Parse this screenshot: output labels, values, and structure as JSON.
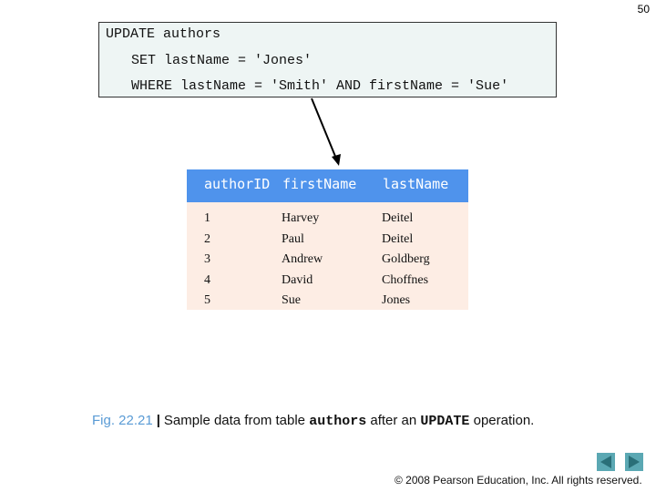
{
  "page_number": "50",
  "code": {
    "line1": "UPDATE authors",
    "line2": "SET lastName = 'Jones'",
    "line3": "WHERE lastName = 'Smith' AND firstName = 'Sue'"
  },
  "table": {
    "headers": [
      "authorID",
      "firstName",
      "lastName"
    ],
    "rows": [
      [
        "1",
        "Harvey",
        "Deitel"
      ],
      [
        "2",
        "Paul",
        "Deitel"
      ],
      [
        "3",
        "Andrew",
        "Goldberg"
      ],
      [
        "4",
        "David",
        "Choffnes"
      ],
      [
        "5",
        "Sue",
        "Jones"
      ]
    ]
  },
  "caption": {
    "fig_label": "Fig. 22.21",
    "separator": "|",
    "text1": "Sample data from table",
    "code1": "authors",
    "text2": "after an",
    "code2": "UPDATE",
    "text3": "operation."
  },
  "nav": {
    "prev_icon": "triangle-left",
    "next_icon": "triangle-right"
  },
  "copyright": "© 2008 Pearson Education, Inc.  All rights reserved.",
  "colors": {
    "header_bg": "#4f93ec",
    "table_bg": "#fdede4",
    "code_bg": "#eef5f4",
    "fig_label": "#5a9bd5",
    "nav_button": "#5ba8b3"
  }
}
